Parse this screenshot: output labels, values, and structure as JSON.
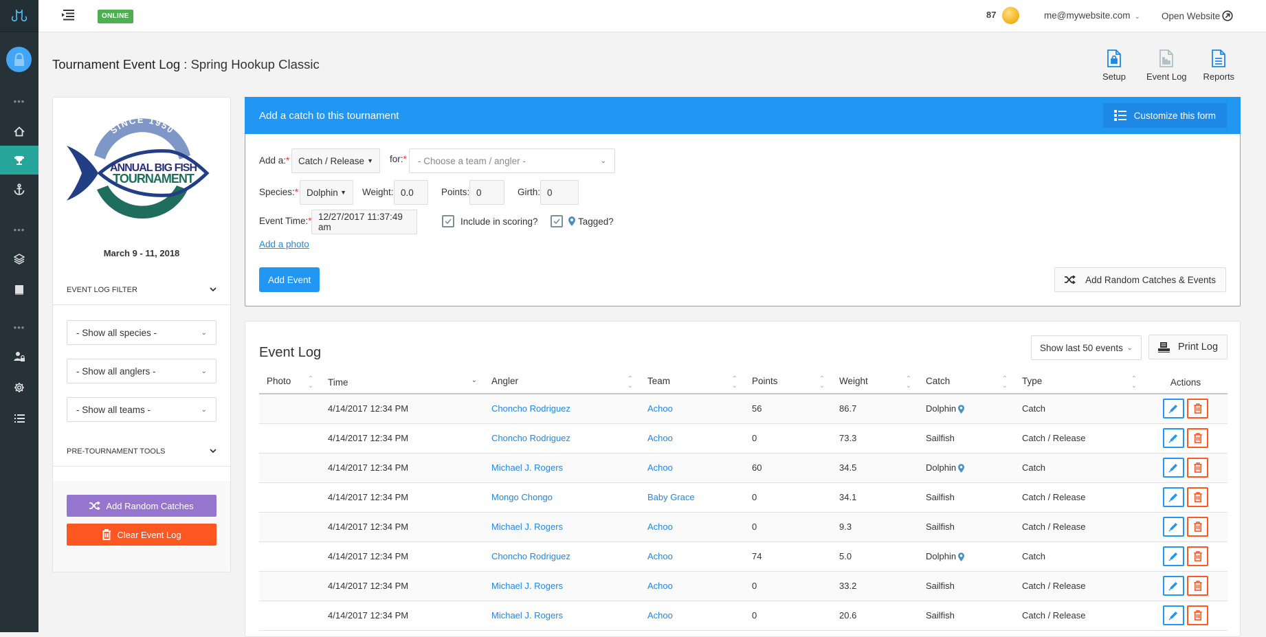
{
  "header": {
    "status_badge": "ONLINE",
    "credits": "87",
    "user_email": "me@mywebsite.com",
    "open_website": "Open Website"
  },
  "page": {
    "title_main": "Tournament Event Log",
    "title_sep": " : ",
    "title_sub": "Spring Hookup Classic"
  },
  "top_actions": [
    {
      "label": "Setup",
      "icon": "lock-document-icon"
    },
    {
      "label": "Event Log",
      "icon": "chart-document-icon"
    },
    {
      "label": "Reports",
      "icon": "text-document-icon"
    }
  ],
  "sidebar": {
    "items": [
      "more",
      "home",
      "tournaments",
      "anchor",
      "more",
      "layers",
      "book",
      "more",
      "user-lock",
      "settings",
      "list"
    ],
    "active": "tournaments"
  },
  "left_panel": {
    "logo_text": {
      "top": "SINCE 1950",
      "line1": "ANNUAL BIG FISH",
      "line2": "TOURNAMENT"
    },
    "event_dates": "March 9 - 11, 2018",
    "filter_section": "EVENT LOG FILTER",
    "filters": [
      "- Show all species -",
      "- Show all anglers -",
      "- Show all teams -"
    ],
    "tools_section": "PRE-TOURNAMENT TOOLS",
    "add_random_label": "Add Random Catches",
    "clear_log_label": "Clear Event Log"
  },
  "form": {
    "heading": "Add a catch to this tournament",
    "customize_label": "Customize this form",
    "add_a_label": "Add a:",
    "add_a_value": "Catch / Release",
    "for_label": "for:",
    "for_placeholder": "- Choose a team / angler -",
    "species_label": "Species:",
    "species_value": "Dolphin",
    "weight_label": "Weight:",
    "weight_value": "0.0",
    "points_label": "Points:",
    "points_value": "0",
    "girth_label": "Girth:",
    "girth_value": "0",
    "event_time_label": "Event Time:",
    "event_time_value": "12/27/2017 11:37:49 am",
    "include_scoring_label": "Include in scoring?",
    "include_scoring_checked": true,
    "tagged_label": "Tagged?",
    "tagged_checked": true,
    "add_photo_label": "Add a photo",
    "add_event_label": "Add Event",
    "add_random_events_label": "Add Random Catches & Events",
    "required_mark": "*"
  },
  "event_log": {
    "title": "Event Log",
    "show_select": "Show last 50 events",
    "print_label": "Print Log",
    "columns": [
      "Photo",
      "Time",
      "Angler",
      "Team",
      "Points",
      "Weight",
      "Catch",
      "Type",
      "Actions"
    ],
    "rows": [
      {
        "time": "4/14/2017 12:34 PM",
        "angler": "Choncho Rodriguez",
        "team": "Achoo",
        "points": "56",
        "weight": "86.7",
        "catch": "Dolphin",
        "tagged": true,
        "type": "Catch"
      },
      {
        "time": "4/14/2017 12:34 PM",
        "angler": "Choncho Rodriguez",
        "team": "Achoo",
        "points": "0",
        "weight": "73.3",
        "catch": "Sailfish",
        "tagged": false,
        "type": "Catch / Release"
      },
      {
        "time": "4/14/2017 12:34 PM",
        "angler": "Michael J. Rogers",
        "team": "Achoo",
        "points": "60",
        "weight": "34.5",
        "catch": "Dolphin",
        "tagged": true,
        "type": "Catch"
      },
      {
        "time": "4/14/2017 12:34 PM",
        "angler": "Mongo Chongo",
        "team": "Baby Grace",
        "points": "0",
        "weight": "34.1",
        "catch": "Sailfish",
        "tagged": false,
        "type": "Catch / Release"
      },
      {
        "time": "4/14/2017 12:34 PM",
        "angler": "Michael J. Rogers",
        "team": "Achoo",
        "points": "0",
        "weight": "9.3",
        "catch": "Sailfish",
        "tagged": false,
        "type": "Catch / Release"
      },
      {
        "time": "4/14/2017 12:34 PM",
        "angler": "Choncho Rodriguez",
        "team": "Achoo",
        "points": "74",
        "weight": "5.0",
        "catch": "Dolphin",
        "tagged": true,
        "type": "Catch"
      },
      {
        "time": "4/14/2017 12:34 PM",
        "angler": "Michael J. Rogers",
        "team": "Achoo",
        "points": "0",
        "weight": "33.2",
        "catch": "Sailfish",
        "tagged": false,
        "type": "Catch / Release"
      },
      {
        "time": "4/14/2017 12:34 PM",
        "angler": "Michael J. Rogers",
        "team": "Achoo",
        "points": "0",
        "weight": "20.6",
        "catch": "Sailfish",
        "tagged": false,
        "type": "Catch / Release"
      }
    ]
  },
  "colors": {
    "sidebar": "#263238",
    "sidebar_active": "#26a69a",
    "primary": "#2196f3",
    "online": "#4caf50",
    "purple": "#9575cd",
    "danger": "#ff5722"
  }
}
